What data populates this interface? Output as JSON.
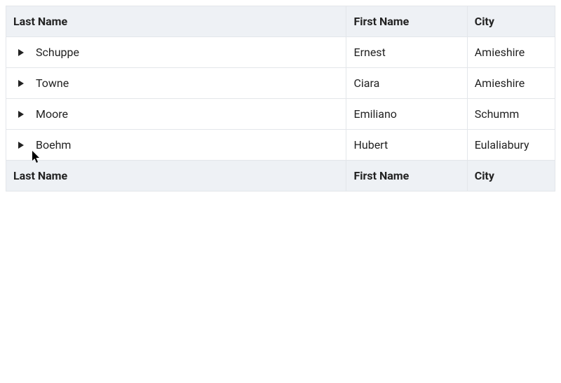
{
  "columns": {
    "last_name": "Last Name",
    "first_name": "First Name",
    "city": "City"
  },
  "rows": [
    {
      "last_name": "Schuppe",
      "first_name": "Ernest",
      "city": "Amieshire"
    },
    {
      "last_name": "Towne",
      "first_name": "Ciara",
      "city": "Amieshire"
    },
    {
      "last_name": "Moore",
      "first_name": "Emiliano",
      "city": "Schumm"
    },
    {
      "last_name": "Boehm",
      "first_name": "Hubert",
      "city": "Eulaliabury"
    }
  ],
  "footer": {
    "last_name": "Last Name",
    "first_name": "First Name",
    "city": "City"
  }
}
